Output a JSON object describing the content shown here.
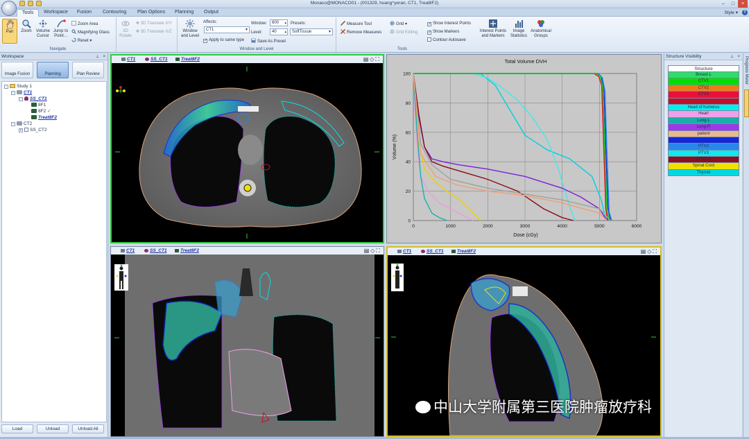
{
  "window": {
    "title": "Monaco@MONACO01 - (001329, huang^yeran, CT1, Treat8F2)"
  },
  "ribbon_tabs": [
    "Tools",
    "Workspace",
    "Fusion",
    "Contouring",
    "Plan Options",
    "Planning",
    "Output"
  ],
  "style_menu": "Style",
  "navigate": {
    "label": "Navigate",
    "pan": "Pan",
    "zoom": "Zoom",
    "volume_cursor": "Volume Cursor",
    "jump_to_point": "Jump to Point...",
    "zoom_area": "Zoom Area",
    "magnifying_glass": "Magnifying Glass",
    "reset": "Reset"
  },
  "rotate": {
    "label_3d": "3D Rotate",
    "translate_xy": "3D Translate X/Y",
    "translate_xz": "3D Translate X/Z"
  },
  "window_level": {
    "label": "Window and Level",
    "wl_button": "Window and Level",
    "affects_label": "Affects:",
    "affects_value": "CT1",
    "window_label": "Window:",
    "window_value": "600",
    "level_label": "Level:",
    "level_value": "40",
    "presets_label": "Presets:",
    "presets_value": "SoftTissue",
    "apply_same_type": "Apply to same type",
    "save_as_preset": "Save As Preset"
  },
  "tools": {
    "label": "Tools",
    "measure_tool": "Measure Tool",
    "remove_measures": "Remove Measures",
    "grid": "Grid",
    "grid_editing": "Grid Editing",
    "show_interest_points": "Show Interest Points",
    "show_markers": "Show Markers",
    "contour_autosave": "Contour Autosave",
    "interest_points_markers": "Interest Points and Markers",
    "image_statistics": "Image Statistics",
    "anatomical_groups": "Anatomical Groups"
  },
  "workspace": {
    "title": "Workspace",
    "buttons": [
      "Image Fusion",
      "Planning",
      "Plan Review"
    ],
    "tree": {
      "study": "Study 1",
      "ct1": "CT1",
      "ss_ct1": "SS_CT1",
      "plan1": "8F1",
      "plan2": "8F2",
      "treat": "Treat8F2",
      "ct2": "CT2",
      "ss_ct2": "SS_CT2"
    },
    "footer": [
      "Load",
      "Unload",
      "Unload All"
    ]
  },
  "viewport_header": {
    "image": "CT1",
    "structure_set": "SS_CT1",
    "plan": "Treat8F2"
  },
  "chart_data": {
    "type": "line",
    "title": "Total Volume DVH",
    "xlabel": "Dose (cGy)",
    "ylabel": "Volume (%)",
    "xlim": [
      0,
      6000
    ],
    "ylim": [
      0,
      100
    ],
    "xticks": [
      0,
      1000,
      2000,
      3000,
      4000,
      5000,
      6000
    ],
    "yticks": [
      0,
      20,
      40,
      60,
      80,
      100
    ],
    "grid": true,
    "series": [
      {
        "color": "#00d0e0",
        "x": [
          0,
          200,
          900,
          1800,
          2200,
          2600,
          3000,
          3600,
          4200,
          4800,
          5050,
          5150,
          5250
        ],
        "y": [
          100,
          100,
          100,
          100,
          92,
          75,
          58,
          48,
          42,
          30,
          14,
          3,
          0
        ]
      },
      {
        "color": "#40e8f0",
        "x": [
          0,
          1600,
          2000,
          2400,
          2800,
          3200,
          3600,
          3900,
          4100,
          4250,
          4350
        ],
        "y": [
          100,
          100,
          97,
          90,
          82,
          70,
          55,
          35,
          18,
          6,
          0
        ]
      },
      {
        "color": "#e05010",
        "x": [
          0,
          4900,
          5000,
          5080,
          5130,
          5180,
          5230
        ],
        "y": [
          100,
          100,
          99,
          95,
          60,
          10,
          0
        ]
      },
      {
        "color": "#e8101c",
        "x": [
          0,
          4850,
          4980,
          5060,
          5110,
          5170,
          5220
        ],
        "y": [
          100,
          100,
          98,
          92,
          55,
          8,
          0
        ]
      },
      {
        "color": "#0c30c8",
        "x": [
          0,
          4950,
          5050,
          5120,
          5170,
          5230,
          5300
        ],
        "y": [
          100,
          100,
          98,
          90,
          50,
          8,
          0
        ]
      },
      {
        "color": "#2a86e8",
        "x": [
          0,
          4980,
          5080,
          5150,
          5200,
          5260,
          5330
        ],
        "y": [
          100,
          100,
          97,
          88,
          48,
          6,
          0
        ]
      },
      {
        "color": "#00e020",
        "x": [
          0,
          4920,
          5020,
          5090,
          5140,
          5200,
          5270
        ],
        "y": [
          100,
          100,
          98,
          91,
          52,
          7,
          0
        ]
      },
      {
        "color": "#7a20d8",
        "x": [
          0,
          150,
          300,
          500,
          800,
          1200,
          2000,
          3000,
          4000,
          4500,
          5000,
          5200
        ],
        "y": [
          100,
          70,
          50,
          42,
          40,
          38,
          35,
          30,
          22,
          16,
          8,
          0
        ]
      },
      {
        "color": "#8a0a18",
        "x": [
          0,
          150,
          300,
          500,
          800,
          1200,
          2000,
          2800,
          3500,
          4000,
          4300
        ],
        "y": [
          100,
          72,
          50,
          40,
          37,
          34,
          28,
          20,
          8,
          2,
          0
        ]
      },
      {
        "color": "#f0d000",
        "x": [
          0,
          120,
          300,
          600,
          900,
          1200,
          1500,
          1800
        ],
        "y": [
          100,
          55,
          35,
          26,
          20,
          15,
          8,
          0
        ]
      },
      {
        "color": "#f09ad8",
        "x": [
          0,
          80,
          200,
          400,
          700,
          1000,
          1300,
          1600
        ],
        "y": [
          100,
          55,
          30,
          20,
          12,
          8,
          4,
          0
        ]
      },
      {
        "color": "#a0a0a0",
        "x": [
          0,
          200,
          500,
          1000,
          2000,
          3000,
          4000,
          5000,
          5300
        ],
        "y": [
          100,
          52,
          38,
          28,
          22,
          18,
          14,
          8,
          0
        ]
      },
      {
        "color": "#18b0a8",
        "x": [
          0,
          100,
          200,
          300,
          500,
          700,
          900
        ],
        "y": [
          100,
          60,
          30,
          15,
          5,
          2,
          0
        ]
      },
      {
        "color": "#f0a070",
        "x": [
          0,
          200,
          600,
          1200,
          2000,
          3000,
          4000,
          5000,
          5200
        ],
        "y": [
          100,
          45,
          30,
          24,
          20,
          17,
          12,
          5,
          0
        ]
      }
    ]
  },
  "structure_visibility": {
    "title": "Structure Visibility",
    "header": "Structure",
    "items": [
      {
        "name": "Breast-L",
        "color": "#2fdc6c"
      },
      {
        "name": "CTV1",
        "color": "#00e000"
      },
      {
        "name": "CTV2",
        "color": "#f07a18"
      },
      {
        "name": "CTV3",
        "color": "#e8103c"
      },
      {
        "name": "",
        "color": "#c0102a"
      },
      {
        "name": "Head of humerus",
        "color": "#00f0f0"
      },
      {
        "name": "Heart",
        "color": "#f0a0e8"
      },
      {
        "name": "Lung-L",
        "color": "#18b0a8"
      },
      {
        "name": "Lung-R",
        "color": "#9a3ae8"
      },
      {
        "name": "patient",
        "color": "#e8b890"
      },
      {
        "name": "",
        "color": "#1028d8"
      },
      {
        "name": "PTV2",
        "color": "#2a86e8"
      },
      {
        "name": "PTV3",
        "color": "#10e8f0"
      },
      {
        "name": "PTV1+3",
        "color": "#8a1020"
      },
      {
        "name": "Spinal Cord",
        "color": "#f0e000"
      },
      {
        "name": "Thyroid",
        "color": "#00d8e0"
      }
    ]
  },
  "progress_meter": "Progress Meter",
  "watermark": "中山大学附属第三医院肿瘤放疗科"
}
